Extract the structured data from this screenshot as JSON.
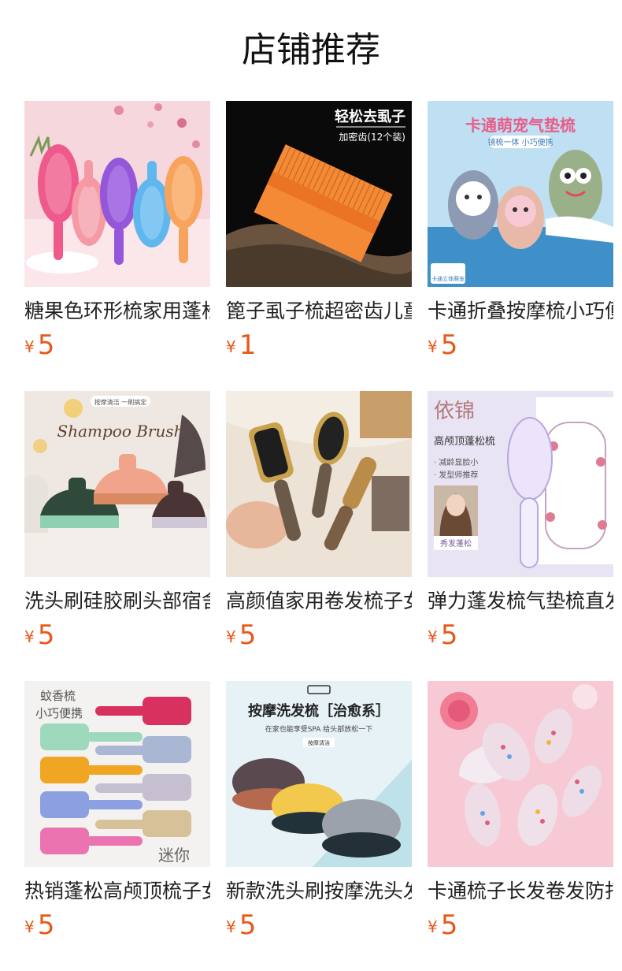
{
  "section": {
    "title": "店铺推荐"
  },
  "currency": "¥",
  "products": [
    {
      "name": "糖果色环形梳家用蓬松",
      "price": "5",
      "image": {
        "caption": "",
        "tag": ""
      }
    },
    {
      "name": "篦子虱子梳超密齿儿童",
      "price": "1",
      "image": {
        "caption": "轻松去虱子",
        "tag": "加密齿(12个装)"
      }
    },
    {
      "name": "卡通折叠按摩梳小巧便携",
      "price": "5",
      "image": {
        "caption": "卡通萌宠气垫梳",
        "tag": "镜梳一体 小巧便携",
        "badge": "卡通立体萌宠"
      }
    },
    {
      "name": "洗头刷硅胶刷头部宿舍",
      "price": "5",
      "image": {
        "caption": "Shampoo Brush",
        "tag": "按摩清洁 一刷搞定"
      }
    },
    {
      "name": "高颜值家用卷发梳子女",
      "price": "5",
      "image": {
        "caption": "",
        "tag": ""
      }
    },
    {
      "name": "弹力蓬发梳气垫梳直发",
      "price": "5",
      "image": {
        "caption": "依锦",
        "tag": "高颅顶蓬松梳",
        "bullets": [
          "· 减龄显脸小",
          "· 发型师推荐"
        ],
        "badge": "秀发蓬松"
      }
    },
    {
      "name": "热销蓬松高颅顶梳子女",
      "price": "5",
      "image": {
        "caption": "蚊香梳",
        "tag": "小巧便携",
        "badge": "迷你"
      }
    },
    {
      "name": "新款洗头刷按摩洗头发",
      "price": "5",
      "image": {
        "caption": "按摩洗发梳［治愈系］",
        "tag": "在家也能享受SPA 给头部放松一下",
        "badge": "按摩清洁"
      }
    },
    {
      "name": "卡通梳子长发卷发防打结",
      "price": "5",
      "image": {
        "caption": "",
        "tag": ""
      }
    }
  ]
}
